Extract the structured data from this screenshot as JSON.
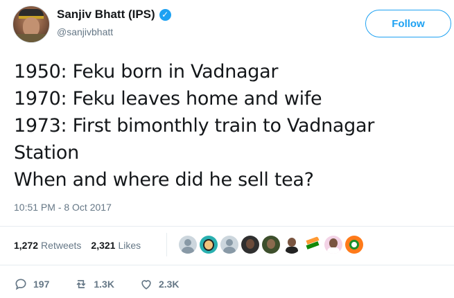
{
  "author": {
    "display_name": "Sanjiv Bhatt (IPS)",
    "handle": "@sanjivbhatt",
    "verified_icon": "verified-badge-icon"
  },
  "follow_button": {
    "label": "Follow",
    "color": "#1da1f2"
  },
  "tweet": {
    "lines": [
      "1950: Feku born in Vadnagar",
      "1970: Feku leaves home and wife",
      "1973: First bimonthly train to Vadnagar",
      "Station",
      "When and where did he sell tea?"
    ],
    "timestamp": "10:51 PM - 8 Oct 2017"
  },
  "stats": {
    "retweets_count": "1,272",
    "retweets_label": "Retweets",
    "likes_count": "2,321",
    "likes_label": "Likes"
  },
  "actions": {
    "reply_count": "197",
    "retweet_count": "1.3K",
    "like_count": "2.3K"
  },
  "colors": {
    "accent": "#1da1f2",
    "muted_text": "#657786",
    "divider": "#e6ecf0"
  }
}
